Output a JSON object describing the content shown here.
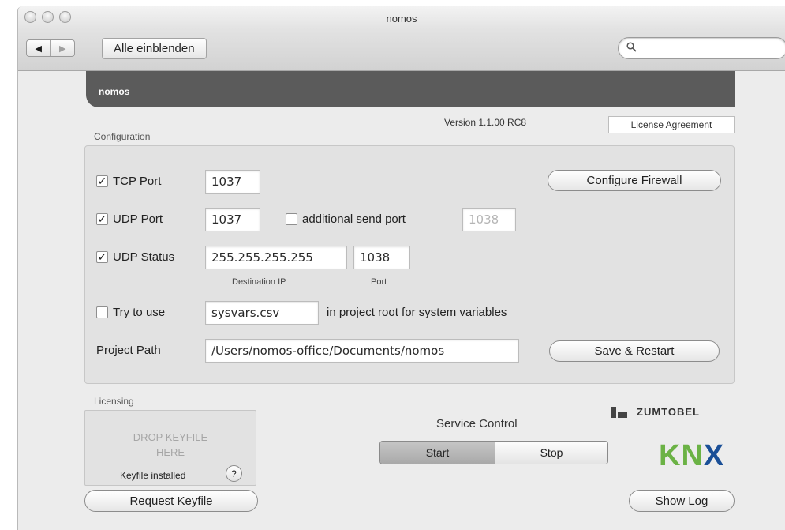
{
  "window": {
    "title": "nomos"
  },
  "toolbar": {
    "back_glyph": "◀",
    "forward_glyph": "▶",
    "show_all_label": "Alle einblenden",
    "search_placeholder": "",
    "search_icon": "search-icon"
  },
  "banner": {
    "title": "nomos"
  },
  "version_text": "Version 1.1.00 RC8",
  "license_button": "License Agreement",
  "configuration": {
    "group_label": "Configuration",
    "tcp": {
      "checked": true,
      "label": "TCP Port",
      "value": "1037"
    },
    "configure_firewall": "Configure Firewall",
    "udp": {
      "checked": true,
      "label": "UDP Port",
      "value": "1037"
    },
    "additional": {
      "checked": false,
      "label": "additional send port",
      "value": "1038"
    },
    "udp_status": {
      "checked": true,
      "label": "UDP Status",
      "ip": "255.255.255.255",
      "port": "1038",
      "ip_caption": "Destination IP",
      "port_caption": "Port"
    },
    "try_use": {
      "checked": false,
      "label": "Try to use",
      "file": "sysvars.csv",
      "suffix": "in project root for system variables"
    },
    "project_path": {
      "label": "Project Path",
      "value": "/Users/nomos-office/Documents/nomos"
    },
    "save_restart": "Save & Restart"
  },
  "licensing": {
    "group_label": "Licensing",
    "drop_line1": "DROP KEYFILE",
    "drop_line2": "HERE",
    "installed": "Keyfile installed",
    "help": "?",
    "request_button": "Request Keyfile"
  },
  "service": {
    "label": "Service Control",
    "start": "Start",
    "stop": "Stop",
    "active": "start"
  },
  "brand": {
    "zumtobel": "ZUMTOBEL",
    "knx_k": "K",
    "knx_n": "N",
    "knx_x": "X",
    "knx_colors": {
      "green": "#6bb245",
      "blue": "#1a4f97"
    }
  },
  "show_log": "Show Log",
  "check_glyph": "✓"
}
